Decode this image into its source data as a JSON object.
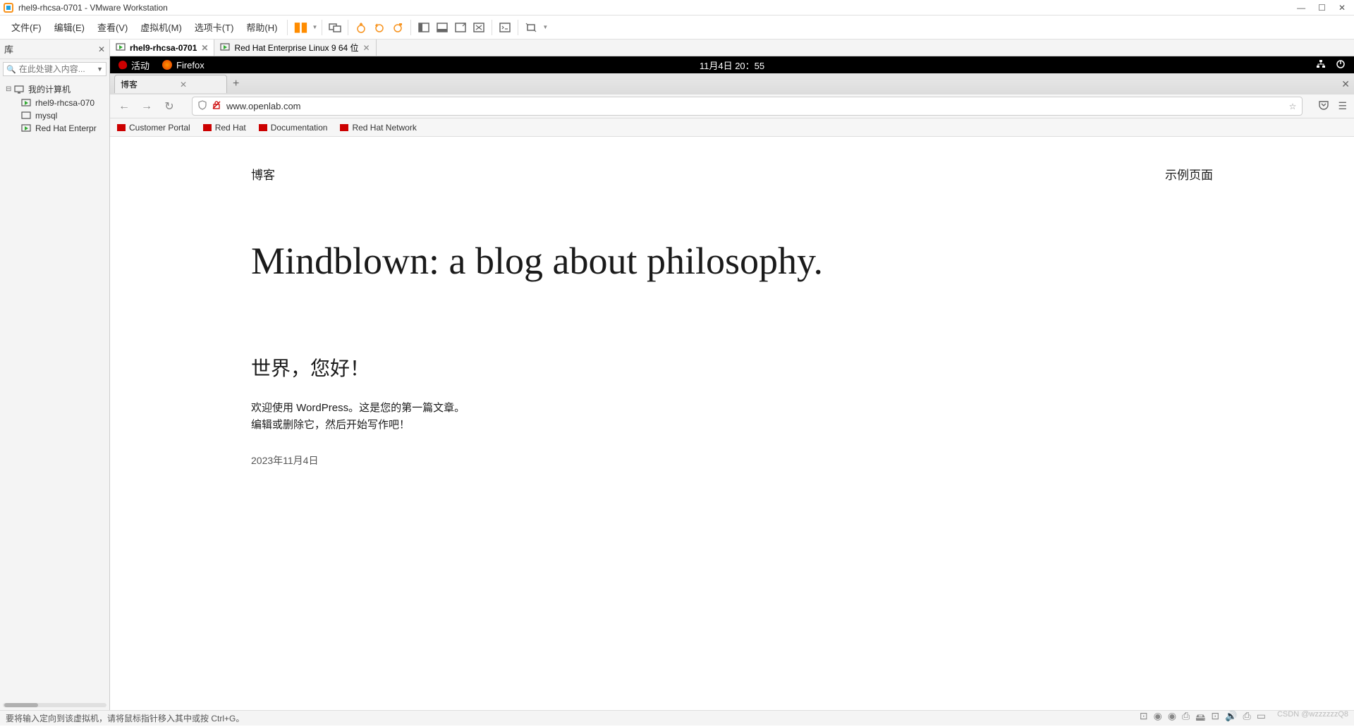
{
  "window": {
    "title": "rhel9-rhcsa-0701 - VMware Workstation"
  },
  "menu": {
    "file": "文件(F)",
    "edit": "编辑(E)",
    "view": "查看(V)",
    "vm": "虚拟机(M)",
    "tabs": "选项卡(T)",
    "help": "帮助(H)"
  },
  "sidebar": {
    "title": "库",
    "search_placeholder": "在此处键入内容...",
    "root": "我的计算机",
    "items": [
      "rhel9-rhcsa-070",
      "mysql",
      "Red Hat Enterpr"
    ]
  },
  "vmtabs": [
    {
      "label": "rhel9-rhcsa-0701",
      "active": true
    },
    {
      "label": "Red Hat Enterprise Linux 9 64 位",
      "active": false
    }
  ],
  "gnome": {
    "activities": "活动",
    "appname": "Firefox",
    "datetime": "11月4日 20：55"
  },
  "firefox": {
    "tab_title": "博客",
    "url": "www.openlab.com",
    "bookmarks": [
      "Customer Portal",
      "Red Hat",
      "Documentation",
      "Red Hat Network"
    ]
  },
  "wp": {
    "site_title": "博客",
    "nav_item": "示例页面",
    "hero": "Mindblown: a blog about philosophy.",
    "post_title": "世界，您好！",
    "post_body": "欢迎使用 WordPress。这是您的第一篇文章。编辑或删除它，然后开始写作吧！",
    "post_date": "2023年11月4日"
  },
  "statusbar": {
    "hint": "要将输入定向到该虚拟机，请将鼠标指针移入其中或按 Ctrl+G。"
  },
  "watermark": "CSDN @wzzzzzzQ8"
}
